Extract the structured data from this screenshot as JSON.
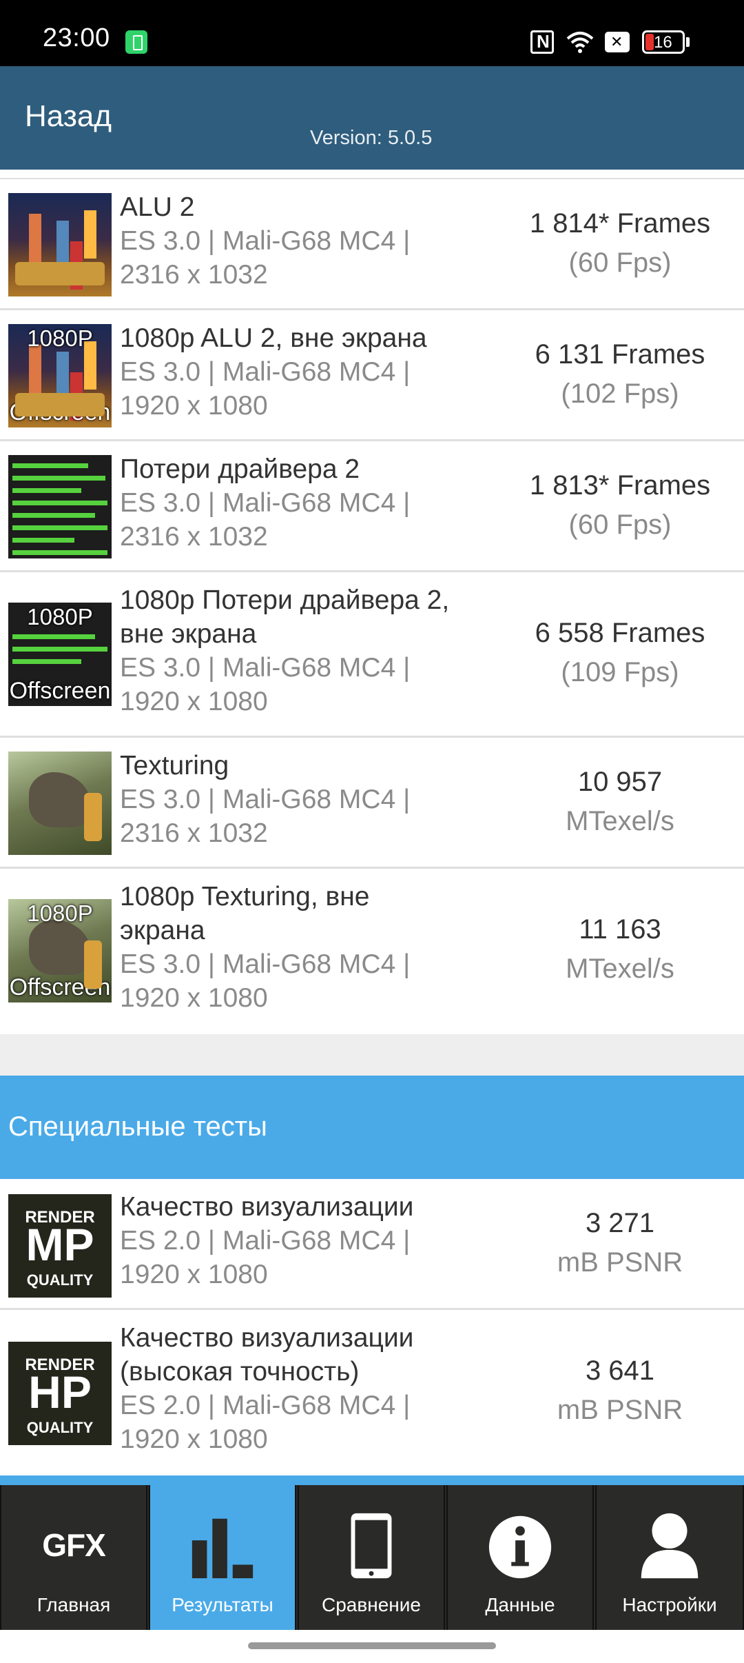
{
  "status_bar": {
    "time": "23:00",
    "battery_level": "16",
    "icons": [
      "battery-saver-icon",
      "nfc-icon",
      "wifi-icon",
      "sim-off-icon",
      "battery-icon"
    ]
  },
  "header": {
    "back_label": "Назад",
    "version": "Version: 5.0.5"
  },
  "results": [
    {
      "name": "ALU 2",
      "sub1": "ES 3.0 | Mali-G68 MC4 |",
      "sub2": "2316 x 1032",
      "score": "1 814* Frames",
      "unit": "(60 Fps)"
    },
    {
      "name": "1080p ALU 2, вне экрана",
      "sub1": "ES 3.0 | Mali-G68 MC4 |",
      "sub2": "1920 x 1080",
      "score": "6 131 Frames",
      "unit": "(102 Fps)",
      "overlay_top": "1080P",
      "overlay_bottom": "Offscreen"
    },
    {
      "name": "Потери драйвера 2",
      "sub1": "ES 3.0 | Mali-G68 MC4 |",
      "sub2": "2316 x 1032",
      "score": "1 813* Frames",
      "unit": "(60 Fps)"
    },
    {
      "name": "1080p Потери драйвера 2,",
      "name2": "вне экрана",
      "sub1": "ES 3.0 | Mali-G68 MC4 |",
      "sub2": "1920 x 1080",
      "score": "6 558 Frames",
      "unit": "(109 Fps)",
      "overlay_top": "1080P",
      "overlay_bottom": "Offscreen"
    },
    {
      "name": "Texturing",
      "sub1": "ES 3.0 | Mali-G68 MC4 |",
      "sub2": "2316 x 1032",
      "score": "10 957",
      "unit": "MTexel/s"
    },
    {
      "name": "1080p Texturing, вне",
      "name2": "экрана",
      "sub1": "ES 3.0 | Mali-G68 MC4 |",
      "sub2": "1920 x 1080",
      "score": "11 163",
      "unit": "MTexel/s",
      "overlay_top": "1080P",
      "overlay_bottom": "Offscreen"
    }
  ],
  "special_section": {
    "title": "Специальные тесты",
    "results": [
      {
        "name": "Качество визуализации",
        "sub1": "ES 2.0 | Mali-G68 MC4 |",
        "sub2": "1920 x 1080",
        "score": "3 271",
        "unit": "mB PSNR",
        "thumb_top": "RENDER",
        "thumb_big": "MP",
        "thumb_bottom": "QUALITY"
      },
      {
        "name": "Качество визуализации",
        "name2": "(высокая точность)",
        "sub1": "ES 2.0 | Mali-G68 MC4 |",
        "sub2": "1920 x 1080",
        "score": "3 641",
        "unit": "mB PSNR",
        "thumb_top": "RENDER",
        "thumb_big": "HP",
        "thumb_bottom": "QUALITY"
      }
    ]
  },
  "bottom_nav": {
    "active_index": 1,
    "tabs": [
      {
        "label": "Главная",
        "icon": "gfx-logo-icon",
        "icon_text": "GFX"
      },
      {
        "label": "Результаты",
        "icon": "bar-chart-icon"
      },
      {
        "label": "Сравнение",
        "icon": "phone-icon"
      },
      {
        "label": "Данные",
        "icon": "info-icon"
      },
      {
        "label": "Настройки",
        "icon": "user-icon"
      }
    ]
  },
  "colors": {
    "header_bg": "#2f5d7d",
    "accent_blue": "#4aaae8",
    "nav_bg": "#2a2a28",
    "bars_green": "#56d23e"
  }
}
